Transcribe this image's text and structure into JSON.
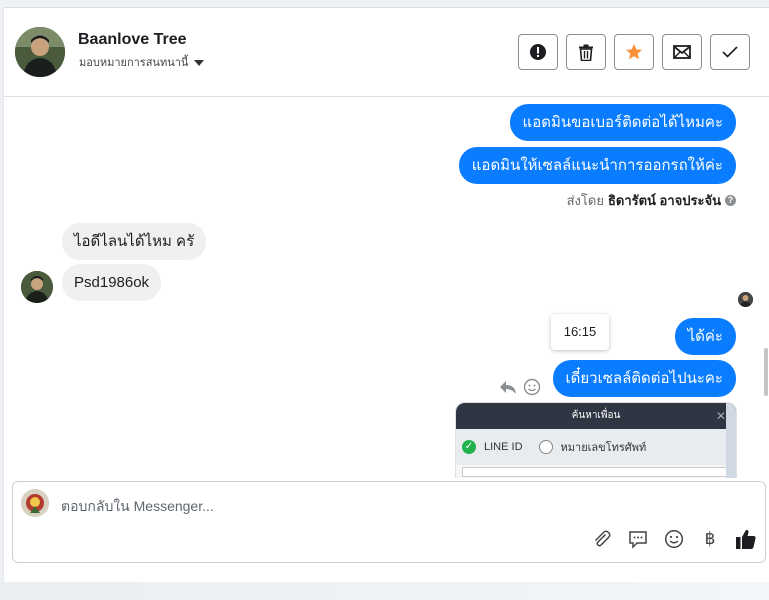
{
  "header": {
    "contact_name": "Baanlove Tree",
    "assign_label": "มอบหมายการสนทนานี้",
    "actions": [
      {
        "name": "spam-button",
        "icon": "alert-icon"
      },
      {
        "name": "delete-button",
        "icon": "trash-icon"
      },
      {
        "name": "star-button",
        "icon": "star-icon",
        "color": "#f7923a"
      },
      {
        "name": "unread-button",
        "icon": "envelope-icon"
      },
      {
        "name": "done-button",
        "icon": "check-icon"
      }
    ]
  },
  "messages": {
    "out_1": "แอดมินขอเบอร์ติดต่อได้ไหมคะ",
    "out_2": "แอดมินให้เซลล์แนะนำการออกรถให้ค่ะ",
    "sent_by_prefix": "ส่งโดย",
    "sent_by_name": "ธิดารัตน์ อาจประจัน",
    "in_1": "ไอดีไลนได้ไหม ครั",
    "in_2": "Psd1986ok",
    "tooltip_time": "16:15",
    "out_3": "ได้ค่ะ",
    "out_4": "เดี๋ยวเซลล์ติดต่อไปนะคะ"
  },
  "attachment": {
    "title": "ค้นหาเพื่อน",
    "option_1": "LINE ID",
    "option_2": "หมายเลขโทรศัพท์"
  },
  "composer": {
    "placeholder": "ตอบกลับใน Messenger...",
    "currency_symbol": "฿"
  },
  "colors": {
    "outgoing_bubble": "#0a7cff",
    "incoming_bubble": "#f0f0f0",
    "star": "#f7923a",
    "line_green": "#22b14c"
  }
}
